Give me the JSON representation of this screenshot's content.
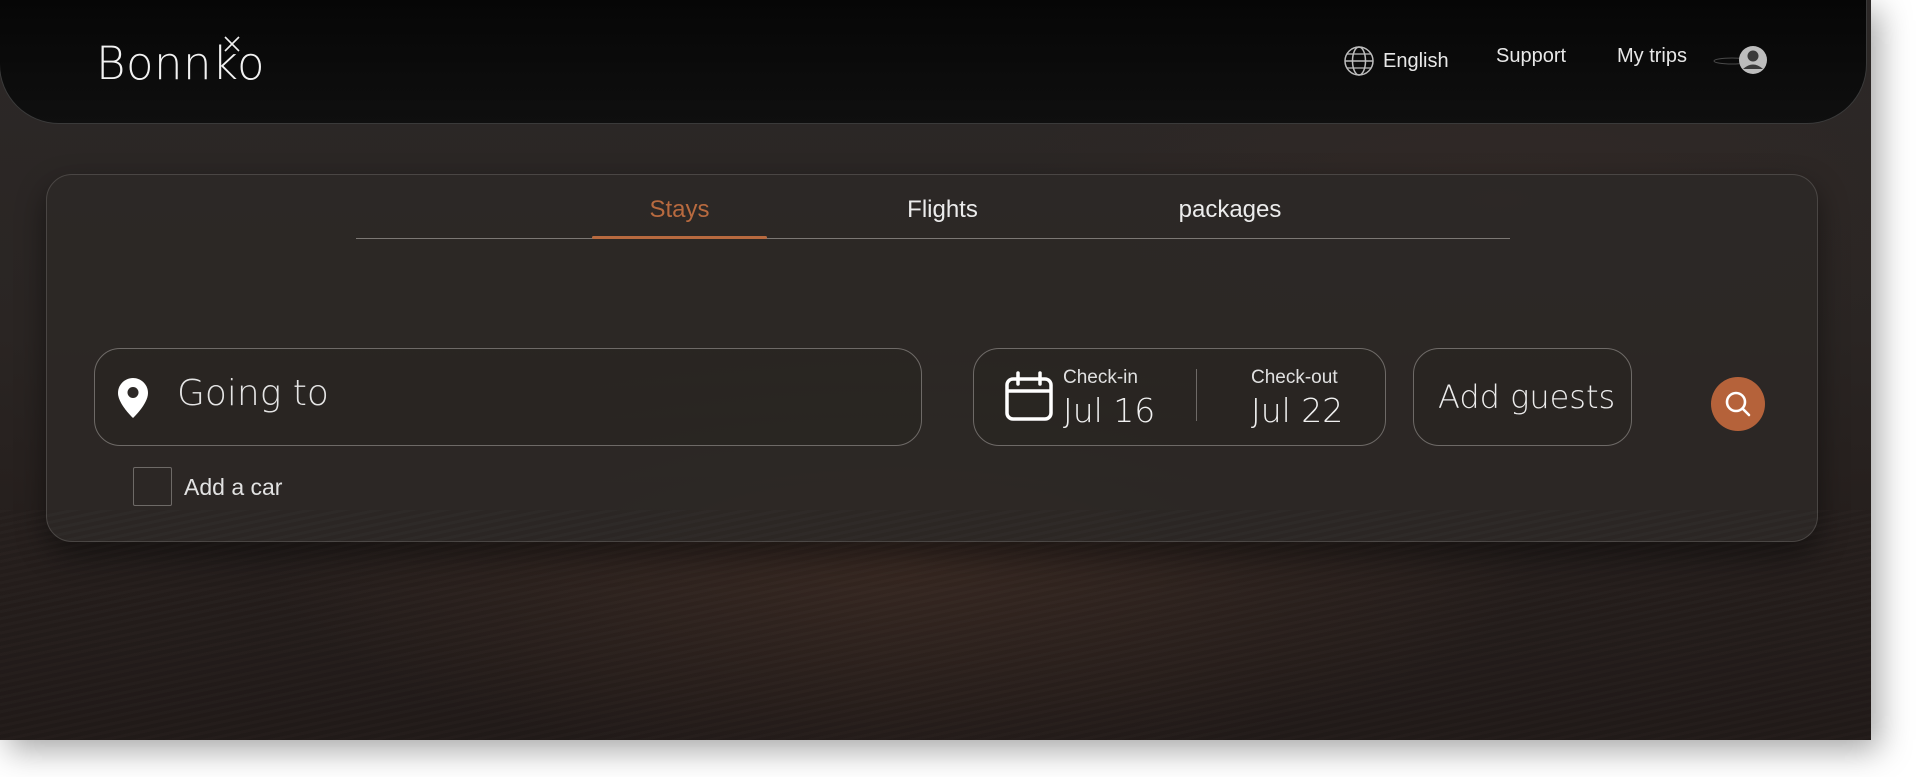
{
  "brand": {
    "name": "Bonnko"
  },
  "header": {
    "language": "English",
    "support": "Support",
    "trips": "My trips",
    "icons": {
      "language": "globe-icon",
      "account": "user-avatar-icon"
    }
  },
  "tabs": [
    {
      "label": "Stays",
      "active": true
    },
    {
      "label": "Flights",
      "active": false
    },
    {
      "label": "packages",
      "active": false
    }
  ],
  "search": {
    "destination_placeholder": "Going to",
    "checkin_label": "Check-in",
    "checkin_value": "Jul 16",
    "checkout_label": "Check-out",
    "checkout_value": "Jul 22",
    "guests_label": "Add guests",
    "add_car_label": "Add a car",
    "add_car_checked": false
  },
  "colors": {
    "accent": "#b86a3f",
    "header_bg": "#0a0a0a",
    "panel_bg": "#2c2826"
  }
}
